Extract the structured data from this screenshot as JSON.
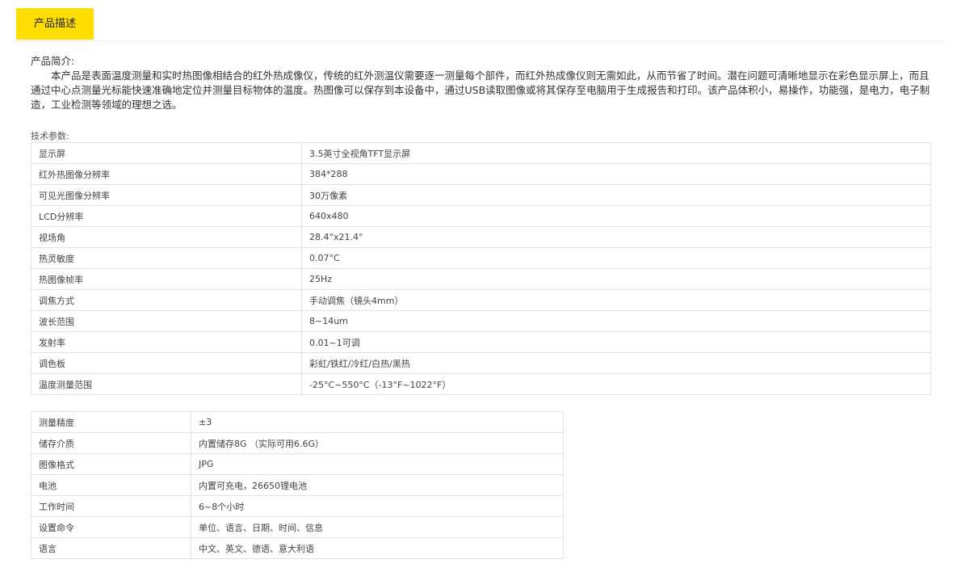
{
  "tabs": [
    {
      "label": "产品描述"
    }
  ],
  "intro": {
    "heading": "产品简介:",
    "body": "本产品是表面温度测量和实时热图像相结合的红外热成像仪，传统的红外测温仪需要逐一测量每个部件，而红外热成像仪则无需如此，从而节省了时间。潜在问题可清晰地显示在彩色显示屏上，而且通过中心点测量光标能快速准确地定位并测量目标物体的温度。热图像可以保存到本设备中，通过USB读取图像或将其保存至电脑用于生成报告和打印。该产品体积小，易操作，功能强，是电力，电子制造，工业检测等领域的理想之选。"
  },
  "specs_label": "技术参数:",
  "specs_table_1": [
    {
      "key": "显示屏",
      "value": "3.5英寸全视角TFT显示屏"
    },
    {
      "key": "红外热图像分辨率",
      "value": "384*288"
    },
    {
      "key": "可见光图像分辨率",
      "value": "30万像素"
    },
    {
      "key": "LCD分辨率",
      "value": "640x480"
    },
    {
      "key": "视场角",
      "value": "28.4°x21.4°"
    },
    {
      "key": "热灵敏度",
      "value": "0.07°C"
    },
    {
      "key": "热图像帧率",
      "value": "25Hz"
    },
    {
      "key": "调焦方式",
      "value": "手动调焦（镜头4mm）"
    },
    {
      "key": "波长范围",
      "value": "8~14um"
    },
    {
      "key": "发射率",
      "value": "0.01~1可调"
    },
    {
      "key": "调色板",
      "value": "彩虹/铁红/冷红/白热/黑热"
    },
    {
      "key": "温度测量范围",
      "value": "-25°C~550°C（-13°F~1022°F）"
    }
  ],
  "specs_table_2": [
    {
      "key": "测量精度",
      "value": "±3"
    },
    {
      "key": "储存介质",
      "value": "内置储存8G （实际可用6.6G）"
    },
    {
      "key": "图像格式",
      "value": "JPG"
    },
    {
      "key": "电池",
      "value": "内置可充电，26650锂电池"
    },
    {
      "key": "工作时间",
      "value": "6~8个小时"
    },
    {
      "key": "设置命令",
      "value": "单位、语言、日期、时间、信息"
    },
    {
      "key": "语言",
      "value": "中文、英文、德语、意大利语"
    }
  ]
}
